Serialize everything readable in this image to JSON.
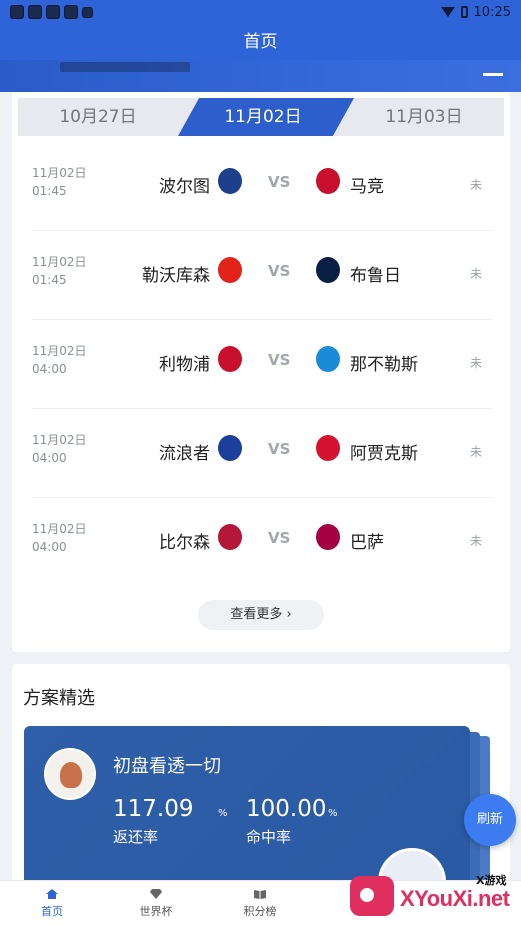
{
  "status_bar": {
    "time": "10:25"
  },
  "header": {
    "title": "首页"
  },
  "date_tabs": [
    {
      "label": "10月27日",
      "active": false
    },
    {
      "label": "11月02日",
      "active": true
    },
    {
      "label": "11月03日",
      "active": false
    }
  ],
  "matches": [
    {
      "date": "11月02日",
      "time": "01:45",
      "home": "波尔图",
      "vs": "VS",
      "away": "马竞",
      "status": "未",
      "home_logo": "porto-crest-icon",
      "away_logo": "atletico-crest-icon",
      "home_color": "#1d3f8c",
      "away_color": "#c8102e"
    },
    {
      "date": "11月02日",
      "time": "01:45",
      "home": "勒沃库森",
      "vs": "VS",
      "away": "布鲁日",
      "status": "未",
      "home_logo": "leverkusen-crest-icon",
      "away_logo": "brugge-crest-icon",
      "home_color": "#e32219",
      "away_color": "#0a1f44"
    },
    {
      "date": "11月02日",
      "time": "04:00",
      "home": "利物浦",
      "vs": "VS",
      "away": "那不勒斯",
      "status": "未",
      "home_logo": "liverpool-crest-icon",
      "away_logo": "napoli-crest-icon",
      "home_color": "#c8102e",
      "away_color": "#1a8bd6"
    },
    {
      "date": "11月02日",
      "time": "04:00",
      "home": "流浪者",
      "vs": "VS",
      "away": "阿贾克斯",
      "status": "未",
      "home_logo": "rangers-crest-icon",
      "away_logo": "ajax-crest-icon",
      "home_color": "#1b3f9a",
      "away_color": "#d2122e"
    },
    {
      "date": "11月02日",
      "time": "04:00",
      "home": "比尔森",
      "vs": "VS",
      "away": "巴萨",
      "status": "未",
      "home_logo": "plzen-crest-icon",
      "away_logo": "barcelona-crest-icon",
      "home_color": "#b5173a",
      "away_color": "#a50044"
    }
  ],
  "more_button": {
    "label": "查看更多 ›"
  },
  "picks": {
    "title": "方案精选",
    "card": {
      "title": "初盘看透一切",
      "return_value": "117.09",
      "return_unit": "%",
      "return_label": "返还率",
      "hit_value": "100.00",
      "hit_unit": "%",
      "hit_label": "命中率"
    }
  },
  "refresh_button": {
    "label": "刷新"
  },
  "bottom_nav": [
    {
      "label": "首页",
      "icon": "home-icon",
      "active": true
    },
    {
      "label": "世界杯",
      "icon": "diamond-icon",
      "active": false
    },
    {
      "label": "积分榜",
      "icon": "book-icon",
      "active": false
    }
  ],
  "watermark": {
    "small": "X游戏",
    "text": "XYouXi.net"
  }
}
